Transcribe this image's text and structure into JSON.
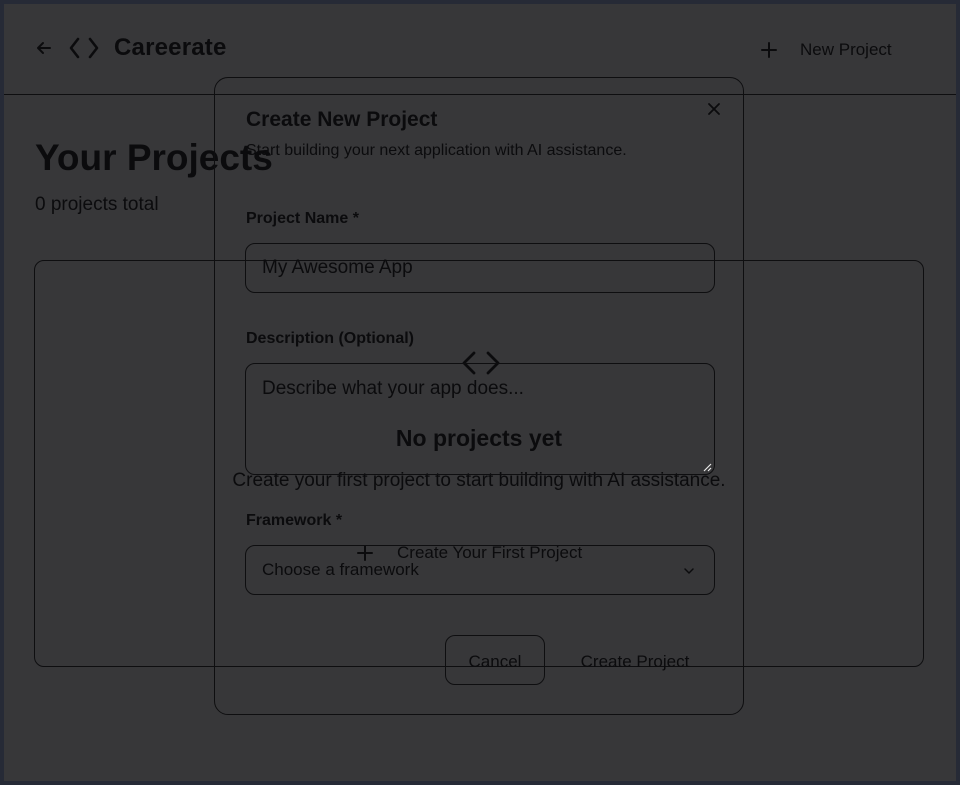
{
  "header": {
    "app_title": "Careerate",
    "new_project_label": "New Project"
  },
  "main": {
    "page_title": "Your Projects",
    "project_count": "0 projects total",
    "empty_state": {
      "title": "No projects yet",
      "description": "Create your first project to start building with AI assistance.",
      "button_label": "Create Your First Project"
    }
  },
  "modal": {
    "title": "Create New Project",
    "subtitle": "Start building your next application with AI assistance.",
    "name_label": "Project Name *",
    "name_placeholder": "My Awesome App",
    "description_label": "Description (Optional)",
    "description_placeholder": "Describe what your app does...",
    "framework_label": "Framework *",
    "framework_placeholder": "Choose a framework",
    "cancel_label": "Cancel",
    "create_label": "Create Project"
  },
  "icons": {
    "back": "arrow-left-icon",
    "logo": "code-icon",
    "add": "plus-icon",
    "close": "close-icon",
    "dropdown": "chevron-down-icon"
  },
  "colors": {
    "background": "#373739",
    "foreground": "#0b0b0d",
    "border": "#0e0e10",
    "frame": "#262a36"
  }
}
